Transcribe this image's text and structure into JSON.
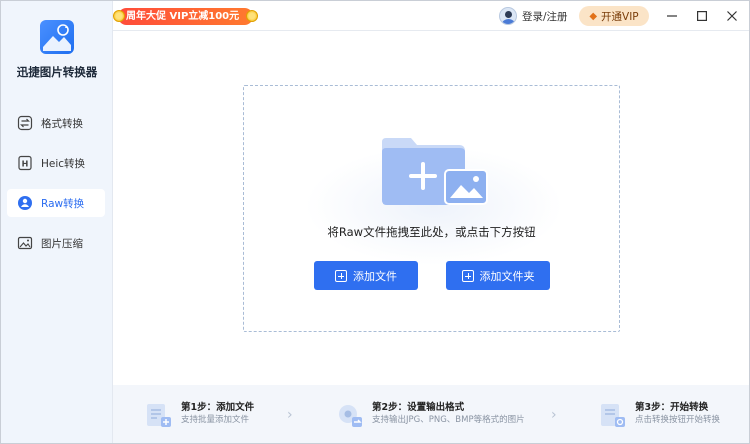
{
  "app": {
    "name": "迅捷图片转换器"
  },
  "sidebar": {
    "items": [
      {
        "label": "格式转换",
        "icon": "format-convert-icon"
      },
      {
        "label": "Heic转换",
        "icon": "heic-icon"
      },
      {
        "label": "Raw转换",
        "icon": "raw-icon",
        "active": true
      },
      {
        "label": "图片压缩",
        "icon": "image-compress-icon"
      }
    ]
  },
  "topbar": {
    "promo": "周年大促 VIP立减100元",
    "login": "登录/注册",
    "vip": "开通VIP"
  },
  "dropzone": {
    "text": "将Raw文件拖拽至此处，或点击下方按钮",
    "add_file": "添加文件",
    "add_folder": "添加文件夹"
  },
  "steps": [
    {
      "title": "第1步：添加文件",
      "desc": "支持批量添加文件"
    },
    {
      "title": "第2步：设置输出格式",
      "desc": "支持输出JPG、PNG、BMP等格式的图片"
    },
    {
      "title": "第3步：开始转换",
      "desc": "点击转换按钮开始转换"
    }
  ],
  "colors": {
    "accent": "#2f6ff0",
    "promo": "#ff4b3a",
    "vip_bg": "#fbe4c7"
  }
}
